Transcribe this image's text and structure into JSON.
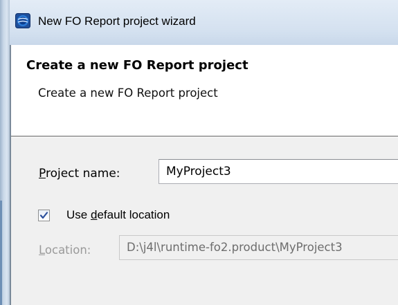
{
  "window": {
    "title": "New FO Report project wizard",
    "icon": "eclipse-app-icon"
  },
  "header": {
    "title": "Create a new FO Report project",
    "description": "Create a new FO Report project"
  },
  "form": {
    "project_name": {
      "label_mnemonic": "P",
      "label_rest": "roject name:",
      "value": "MyProject3"
    },
    "use_default_location": {
      "checked": true,
      "label_before": "Use ",
      "label_mnemonic": "d",
      "label_after": "efault location"
    },
    "location": {
      "label_mnemonic": "L",
      "label_rest": "ocation:",
      "value": "D:\\j4l\\runtime-fo2.product\\MyProject3",
      "enabled": false
    }
  },
  "colors": {
    "titlebar": "#d4e1f0",
    "dialog_body": "#f0f0f0",
    "disabled_text": "#9a9a9a"
  }
}
